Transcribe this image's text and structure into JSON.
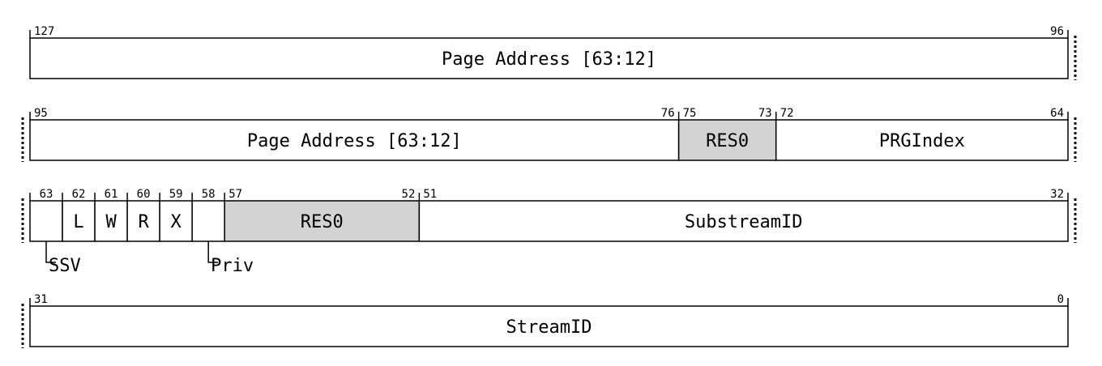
{
  "diagram": {
    "colors": {
      "reserved_fill": "#d3d3d3",
      "field_fill": "#ffffff",
      "line": "#000000"
    },
    "rows": [
      {
        "bits": [
          127,
          96
        ],
        "continues_left": false,
        "continues_right": true,
        "fields": [
          {
            "name": "Page Address [63:12]",
            "hi": 127,
            "lo": 96,
            "reserved": false
          }
        ]
      },
      {
        "bits": [
          95,
          64
        ],
        "continues_left": true,
        "continues_right": true,
        "fields": [
          {
            "name": "Page Address [63:12]",
            "hi": 95,
            "lo": 76,
            "reserved": false
          },
          {
            "name": "RES0",
            "hi": 75,
            "lo": 73,
            "reserved": true
          },
          {
            "name": "PRGIndex",
            "hi": 72,
            "lo": 64,
            "reserved": false
          }
        ]
      },
      {
        "bits": [
          63,
          32
        ],
        "continues_left": true,
        "continues_right": true,
        "fields": [
          {
            "name": "",
            "hi": 63,
            "lo": 63,
            "reserved": false,
            "callout": "SSV"
          },
          {
            "name": "L",
            "hi": 62,
            "lo": 62,
            "reserved": false
          },
          {
            "name": "W",
            "hi": 61,
            "lo": 61,
            "reserved": false
          },
          {
            "name": "R",
            "hi": 60,
            "lo": 60,
            "reserved": false
          },
          {
            "name": "X",
            "hi": 59,
            "lo": 59,
            "reserved": false
          },
          {
            "name": "",
            "hi": 58,
            "lo": 58,
            "reserved": false,
            "callout": "Priv"
          },
          {
            "name": "RES0",
            "hi": 57,
            "lo": 52,
            "reserved": true
          },
          {
            "name": "SubstreamID",
            "hi": 51,
            "lo": 32,
            "reserved": false
          }
        ]
      },
      {
        "bits": [
          31,
          0
        ],
        "continues_left": true,
        "continues_right": false,
        "fields": [
          {
            "name": "StreamID",
            "hi": 31,
            "lo": 0,
            "reserved": false
          }
        ]
      }
    ]
  }
}
